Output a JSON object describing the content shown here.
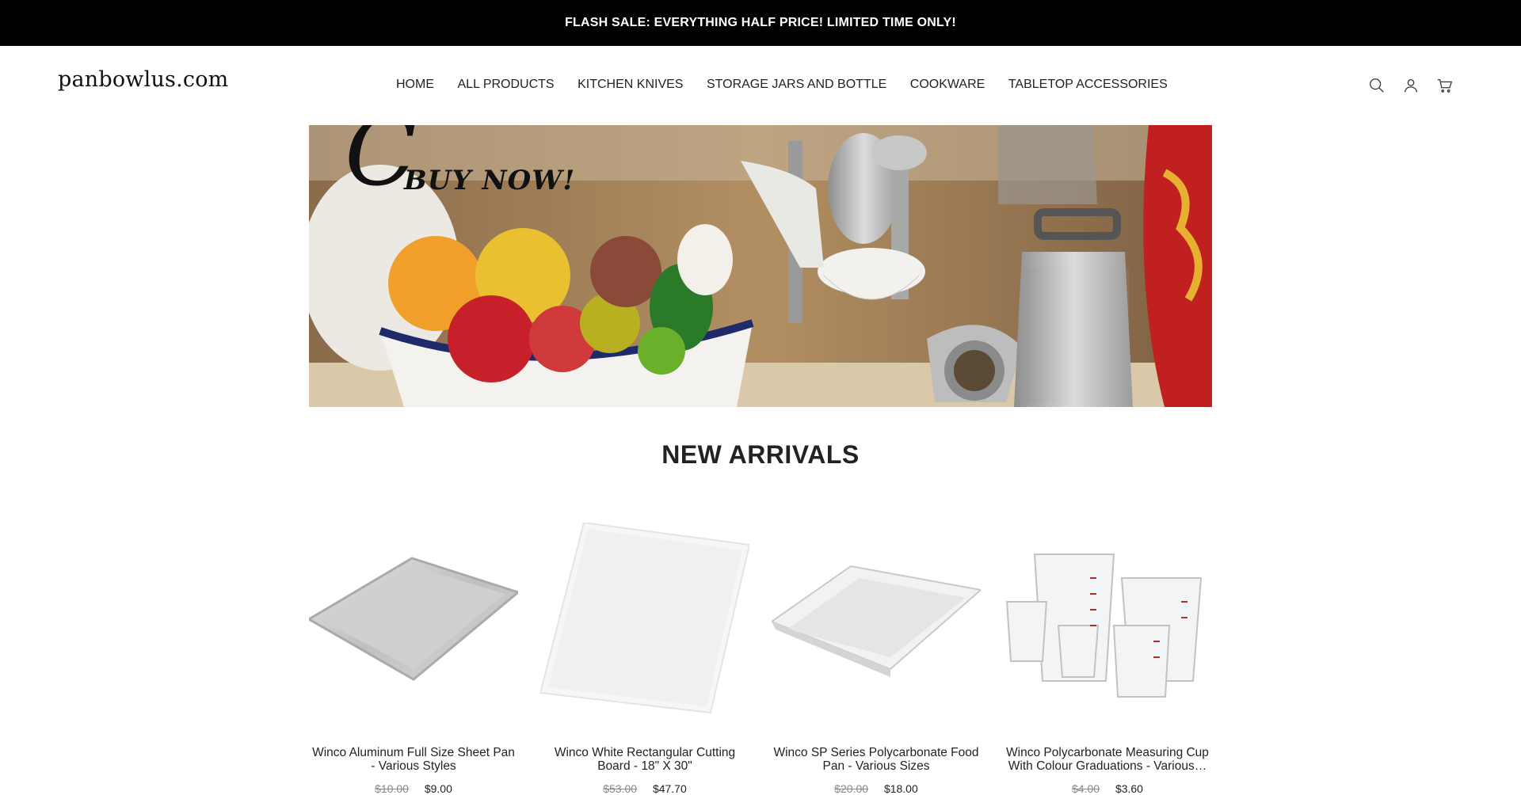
{
  "announcement": "FLASH SALE: EVERYTHING HALF PRICE! LIMITED TIME ONLY!",
  "logo": "panbowlus.com",
  "nav": [
    "HOME",
    "ALL PRODUCTS",
    "KITCHEN KNIVES",
    "STORAGE JARS AND BOTTLE",
    "COOKWARE",
    "TABLETOP ACCESSORIES"
  ],
  "icons": [
    "search-icon",
    "account-icon",
    "cart-icon"
  ],
  "hero": {
    "text": "BUY NOW!",
    "letter": "C"
  },
  "section_title": "NEW ARRIVALS",
  "products": [
    {
      "name": "Winco Aluminum Full Size Sheet Pan - Various Styles",
      "old_price": "$10.00",
      "price": "$9.00"
    },
    {
      "name": "Winco White Rectangular Cutting Board - 18\" X 30\"",
      "old_price": "$53.00",
      "price": "$47.70"
    },
    {
      "name": "Winco SP Series Polycarbonate Food Pan - Various Sizes",
      "old_price": "$20.00",
      "price": "$18.00"
    },
    {
      "name": "Winco Polycarbonate Measuring Cup With Colour Graduations - Various…",
      "old_price": "$4.00",
      "price": "$3.60"
    }
  ],
  "colors": {
    "announce_bg": "#000000",
    "text": "#222222",
    "muted": "#888888"
  }
}
